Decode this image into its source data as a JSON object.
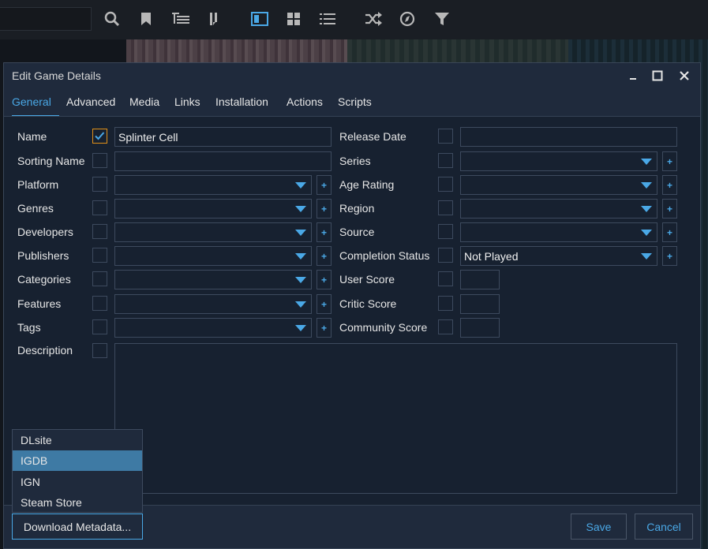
{
  "toolbar": {
    "icons": [
      "search-icon",
      "bookmark-icon",
      "list-tree-icon",
      "sort-icon",
      "details-view-icon",
      "grid-view-icon",
      "list-view-icon",
      "shuffle-icon",
      "explore-icon",
      "filter-icon"
    ]
  },
  "dialog": {
    "title": "Edit Game Details",
    "tabs": [
      "General",
      "Advanced",
      "Media",
      "Links",
      "Installation",
      "Actions",
      "Scripts"
    ],
    "active_tab": "General",
    "left_fields": [
      {
        "label": "Name",
        "value": "Splinter Cell",
        "checked": true
      },
      {
        "label": "Sorting Name",
        "value": ""
      },
      {
        "label": "Platform",
        "value": ""
      },
      {
        "label": "Genres",
        "value": ""
      },
      {
        "label": "Developers",
        "value": ""
      },
      {
        "label": "Publishers",
        "value": ""
      },
      {
        "label": "Categories",
        "value": ""
      },
      {
        "label": "Features",
        "value": ""
      },
      {
        "label": "Tags",
        "value": ""
      },
      {
        "label": "Description",
        "value": ""
      }
    ],
    "right_fields": [
      {
        "label": "Release Date",
        "value": ""
      },
      {
        "label": "Series",
        "value": ""
      },
      {
        "label": "Age Rating",
        "value": ""
      },
      {
        "label": "Region",
        "value": ""
      },
      {
        "label": "Source",
        "value": ""
      },
      {
        "label": "Completion Status",
        "value": "Not Played"
      },
      {
        "label": "User Score",
        "value": ""
      },
      {
        "label": "Critic Score",
        "value": ""
      },
      {
        "label": "Community Score",
        "value": ""
      }
    ],
    "plus_label": "+",
    "metadata_menu": {
      "items": [
        "DLsite",
        "IGDB",
        "IGN",
        "Steam Store"
      ],
      "selected": "IGDB"
    },
    "buttons": {
      "download": "Download Metadata...",
      "save": "Save",
      "cancel": "Cancel"
    }
  },
  "colors": {
    "accent": "#4aa8e6",
    "checked_border": "#e09018",
    "selection": "#3e7aa4"
  }
}
